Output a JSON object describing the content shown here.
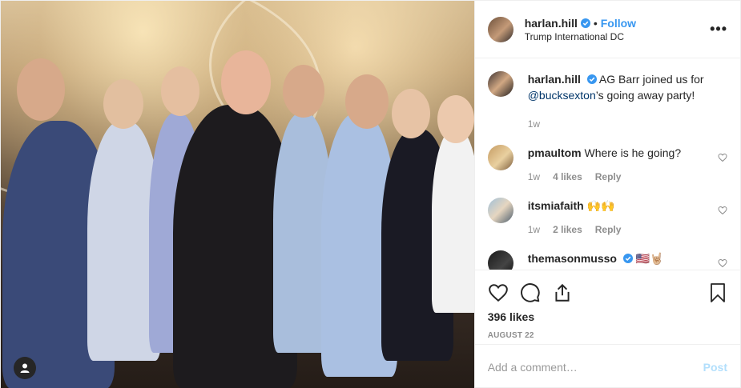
{
  "colors": {
    "accent": "#3897f0",
    "mention": "#003569",
    "muted": "#8e8e8e",
    "post_disabled": "#b2dffc"
  },
  "header": {
    "username": "harlan.hill",
    "dot": "•",
    "follow_label": "Follow",
    "location": "Trump International DC",
    "more_icon": "more-horizontal-icon",
    "more_label": "•••"
  },
  "caption": {
    "username": "harlan.hill",
    "text_before": "AG Barr joined us for",
    "mention": "@bucksexton",
    "text_after": "’s going away party!",
    "time": "1w"
  },
  "comments": [
    {
      "username": "pmaultom",
      "text": "Where is he going?",
      "time": "1w",
      "likes": "4 likes",
      "reply": "Reply"
    },
    {
      "username": "itsmiafaith",
      "text": "🙌🙌",
      "time": "1w",
      "likes": "2 likes",
      "reply": "Reply"
    },
    {
      "username": "themasonmusso",
      "text": "🇺🇸🤘🏼"
    }
  ],
  "actions": {
    "like_icon": "heart-icon",
    "comment_icon": "comment-bubble-icon",
    "share_icon": "share-icon",
    "save_icon": "bookmark-icon"
  },
  "likes": "396 likes",
  "date": "AUGUST 22",
  "add_comment": {
    "placeholder": "Add a comment…",
    "post_label": "Post"
  }
}
